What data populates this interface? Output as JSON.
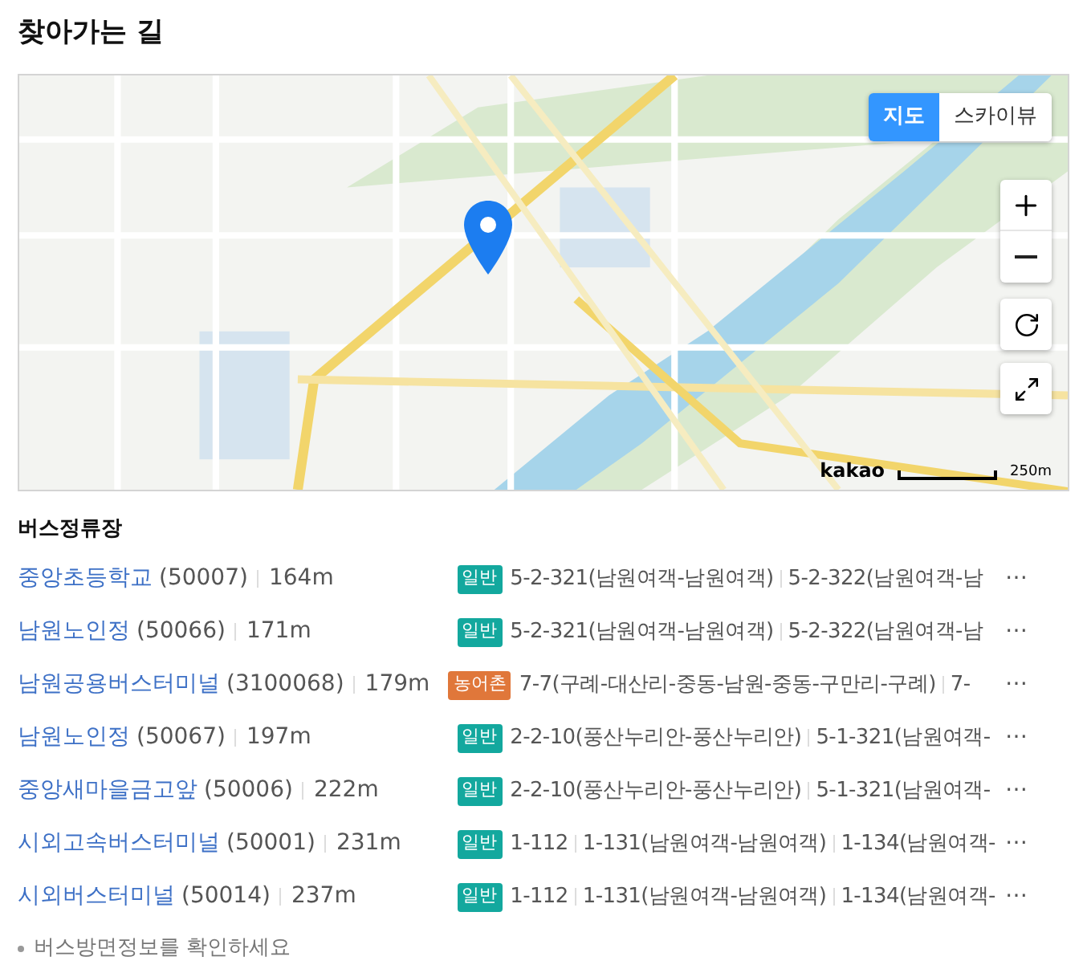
{
  "title": "찾아가는 길",
  "map": {
    "view_toggle": [
      {
        "label": "지도",
        "selected": true
      },
      {
        "label": "스카이뷰",
        "selected": false
      }
    ],
    "logo": "kakao",
    "scale": "250m"
  },
  "bus_stops": {
    "title": "버스정류장",
    "rows": [
      {
        "name": "중앙초등학교",
        "code": "(50007)",
        "distance": "164m",
        "badge": {
          "label": "일반",
          "color": "#13a89e"
        },
        "routes": [
          "5-2-321(남원여객-남원여객)",
          "5-2-322(남원여객-남"
        ],
        "more": "⋯"
      },
      {
        "name": "남원노인정",
        "code": "(50066)",
        "distance": "171m",
        "badge": {
          "label": "일반",
          "color": "#13a89e"
        },
        "routes": [
          "5-2-321(남원여객-남원여객)",
          "5-2-322(남원여객-남"
        ],
        "more": "⋯"
      },
      {
        "name": "남원공용버스터미널",
        "code": "(3100068)",
        "distance": "179m",
        "badge": {
          "label": "농어촌",
          "color": "#e0773a"
        },
        "routes": [
          "7-7(구례-대산리-중동-남원-중동-구만리-구례)",
          "7-"
        ],
        "more": "⋯"
      },
      {
        "name": "남원노인정",
        "code": "(50067)",
        "distance": "197m",
        "badge": {
          "label": "일반",
          "color": "#13a89e"
        },
        "routes": [
          "2-2-10(풍산누리안-풍산누리안)",
          "5-1-321(남원여객-"
        ],
        "more": "⋯"
      },
      {
        "name": "중앙새마을금고앞",
        "code": "(50006)",
        "distance": "222m",
        "badge": {
          "label": "일반",
          "color": "#13a89e"
        },
        "routes": [
          "2-2-10(풍산누리안-풍산누리안)",
          "5-1-321(남원여객-"
        ],
        "more": "⋯"
      },
      {
        "name": "시외고속버스터미널",
        "code": "(50001)",
        "distance": "231m",
        "badge": {
          "label": "일반",
          "color": "#13a89e"
        },
        "routes": [
          "1-112",
          "1-131(남원여객-남원여객)",
          "1-134(남원여객-"
        ],
        "more": "⋯"
      },
      {
        "name": "시외버스터미널",
        "code": "(50014)",
        "distance": "237m",
        "badge": {
          "label": "일반",
          "color": "#13a89e"
        },
        "routes": [
          "1-112",
          "1-131(남원여객-남원여객)",
          "1-134(남원여객-"
        ],
        "more": "⋯"
      }
    ],
    "note": "버스방면정보를 확인하세요"
  }
}
